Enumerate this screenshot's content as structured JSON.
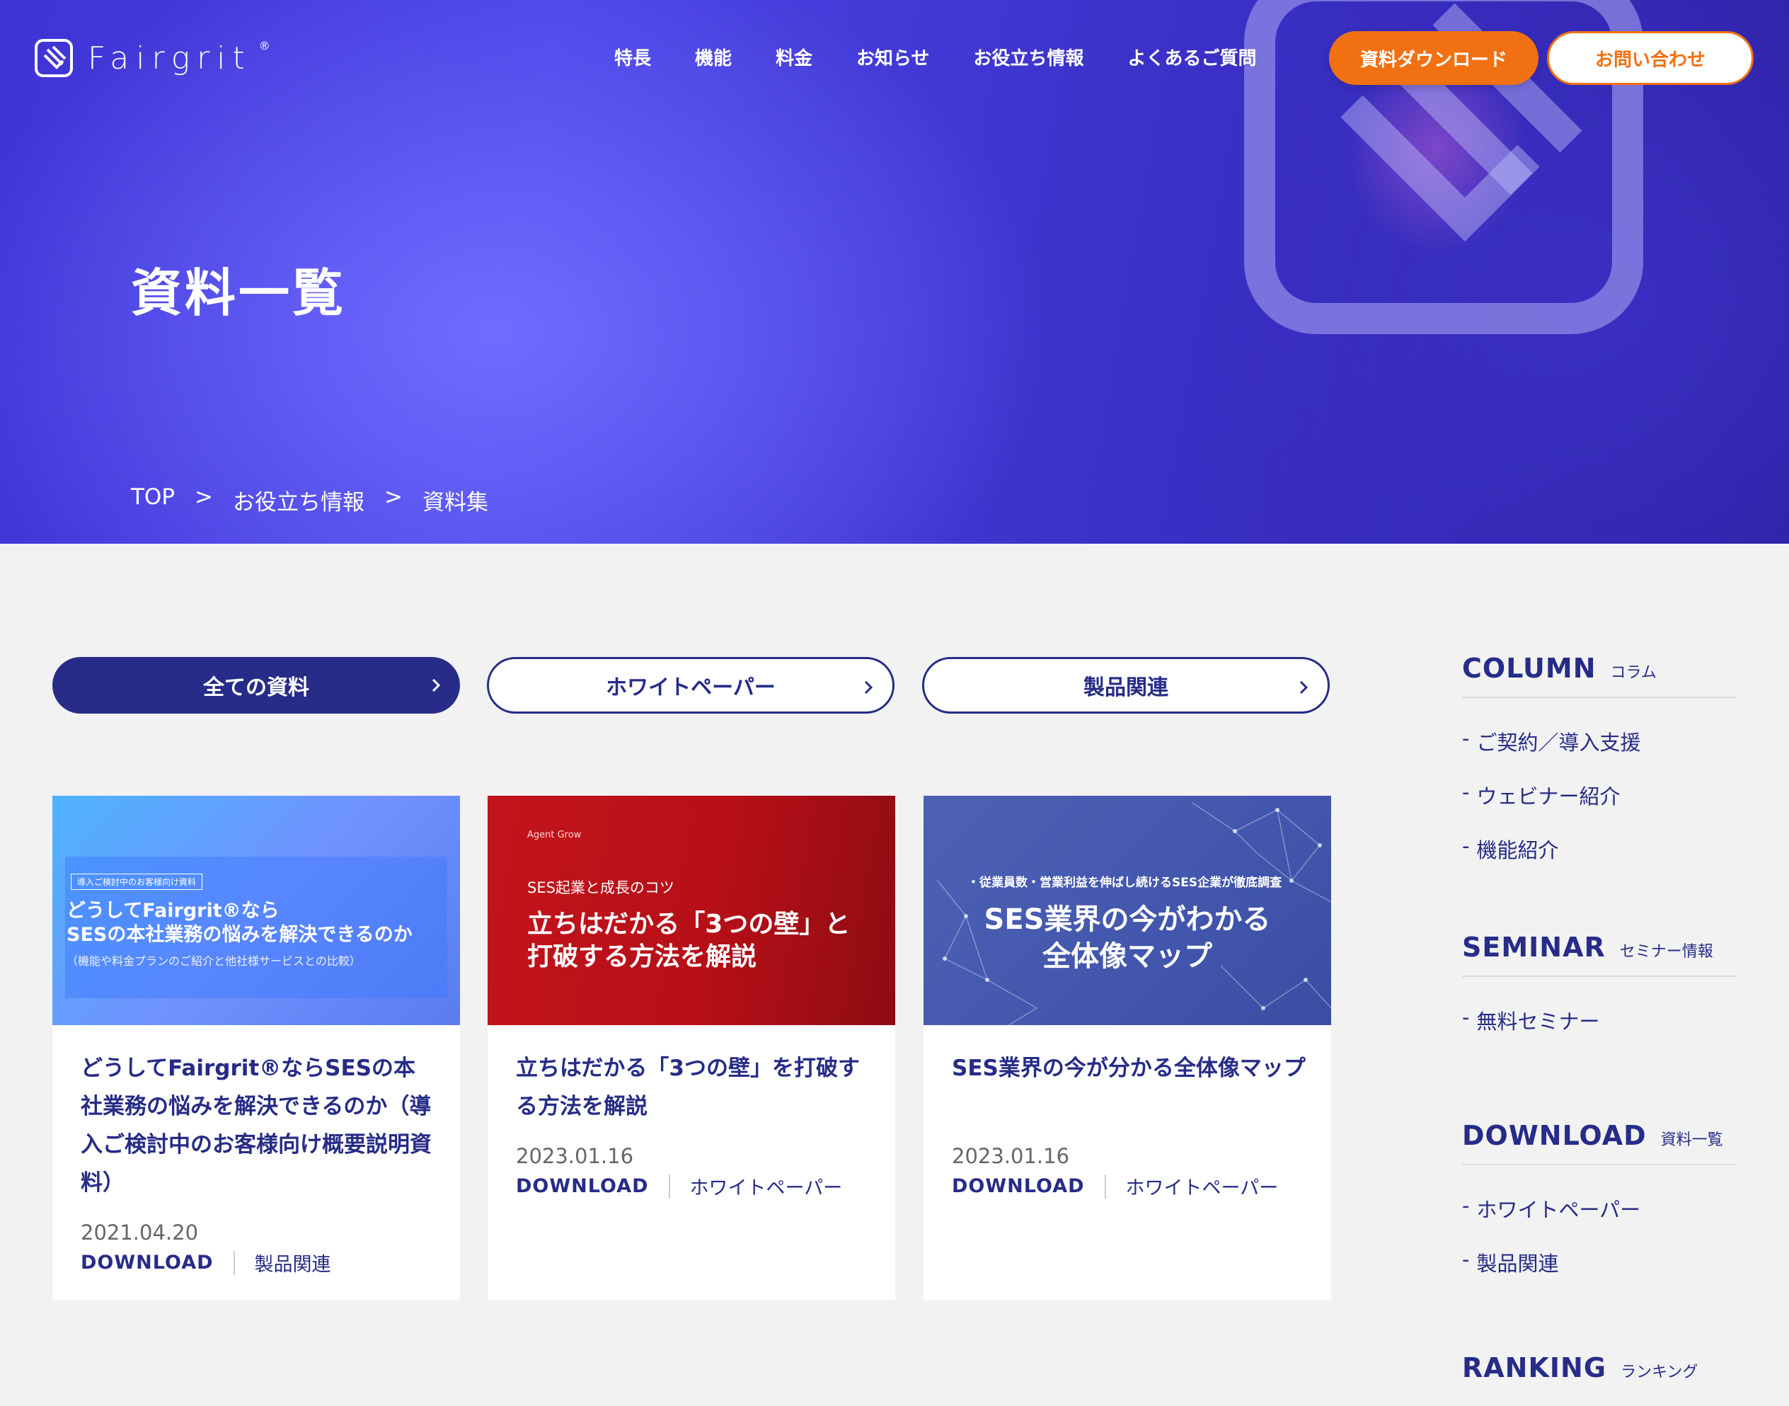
{
  "header": {
    "logo_text": "Fairgrit",
    "logo_reg": "®",
    "nav": [
      "特長",
      "機能",
      "料金",
      "お知らせ",
      "お役立ち情報",
      "よくあるご質問"
    ],
    "download_button": "資料ダウンロード",
    "contact_button": "お問い合わせ"
  },
  "hero": {
    "title": "資料一覧",
    "breadcrumb": [
      "TOP",
      ">",
      "お役立ち情報",
      ">",
      "資料集"
    ]
  },
  "tabs": [
    "全ての資料",
    "ホワイトペーパー",
    "製品関連"
  ],
  "cards": [
    {
      "title": "どうしてFairgrit®ならSESの本社業務の悩みを解決できるのか（導入ご検討中のお客様向け概要説明資料）",
      "date": "2021.04.20",
      "action": "DOWNLOAD",
      "category": "製品関連",
      "thumb": {
        "tag": "導入ご検討中のお客様向け資料",
        "line1": "どうしてFairgrit®なら",
        "line2": "SESの本社業務の悩みを解決できるのか",
        "line3": "（機能や料金プランのご紹介と他社様サービスとの比較）"
      }
    },
    {
      "title": "立ちはだかる「3つの壁」を打破する方法を解説",
      "date": "2023.01.16",
      "action": "DOWNLOAD",
      "category": "ホワイトペーパー",
      "thumb": {
        "brand": "Agent Grow",
        "sub": "SES起業と成長のコツ",
        "line1": "立ちはだかる「3つの壁」と",
        "line2": "打破する方法を解説"
      }
    },
    {
      "title": "SES業界の今が分かる全体像マップ",
      "date": "2023.01.16",
      "action": "DOWNLOAD",
      "category": "ホワイトペーパー",
      "thumb": {
        "sub": "・従業員数・営業利益を伸ばし続けるSES企業が徹底調査",
        "line1": "SES業界の今がわかる",
        "line2": "全体像マップ"
      }
    }
  ],
  "sidebar": {
    "column": {
      "en": "COLUMN",
      "jp": "コラム",
      "items": [
        "ご契約／導入支援",
        "ウェビナー紹介",
        "機能紹介"
      ]
    },
    "seminar": {
      "en": "SEMINAR",
      "jp": "セミナー情報",
      "items": [
        "無料セミナー"
      ]
    },
    "download": {
      "en": "DOWNLOAD",
      "jp": "資料一覧",
      "items": [
        "ホワイトペーパー",
        "製品関連"
      ]
    },
    "ranking": {
      "en": "RANKING",
      "jp": "ランキング"
    },
    "bullet": "-"
  },
  "colors": {
    "navy": "#262c87",
    "orange": "#f17012",
    "hero_blue": "#4a44e6"
  }
}
